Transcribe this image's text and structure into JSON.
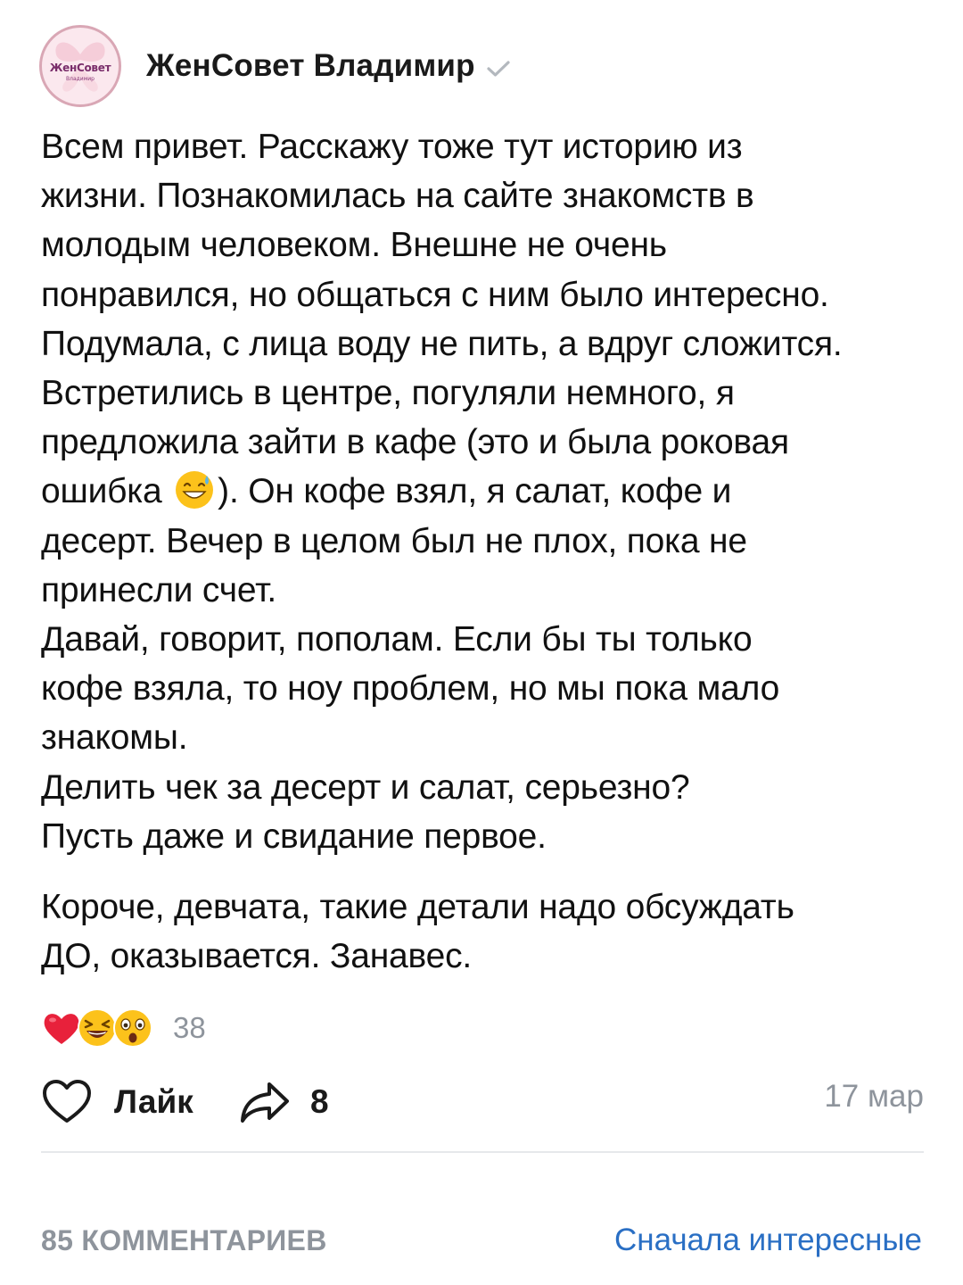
{
  "post": {
    "author": {
      "name": "ЖенСовет Владимир",
      "avatar_title": "ЖенСовет",
      "avatar_subtitle": "Владимир",
      "verified": true
    },
    "text": {
      "line_1": "Всем привет. Расскажу тоже тут историю из",
      "line_2": "жизни. Познакомилась на сайте знакомств в",
      "line_3": "молодым человеком. Внешне не очень",
      "line_4": "понравился, но общаться с ним было интересно.",
      "line_5": "Подумала, с лица воду не пить, а вдруг сложится.",
      "line_6": "Встретились в центре, погуляли немного, я",
      "line_7": "предложила зайти в кафе (это и была роковая",
      "line_8_before_emoji": "ошибка ",
      "line_8_after_emoji": "). Он кофе взял, я салат, кофе и",
      "line_9": "десерт. Вечер в целом был не плох, пока не",
      "line_10": "принесли счет.",
      "line_11": "Давай, говорит, пополам. Если бы ты только",
      "line_12": "кофе взяла, то ноу проблем, но мы пока мало",
      "line_13": "знакомы.",
      "line_14": "Делить чек за десерт и салат, серьезно?",
      "line_15": "Пусть даже и свидание первое.",
      "line_16": "Короче, девчата, такие детали надо обсуждать",
      "line_17": "ДО, оказывается. Занавес."
    },
    "inline_emoji": "grinning-face-with-sweat-icon",
    "reactions": {
      "icons": [
        "red-heart-icon",
        "laughing-squinting-face-icon",
        "astonished-face-icon"
      ],
      "count": "38"
    },
    "actions": {
      "like_label": "Лайк",
      "share_count": "8"
    },
    "date": "17 мар"
  },
  "comments": {
    "count_label": "85 КОММЕНТАРИЕВ",
    "sort_label": "Сначала интересные"
  },
  "colors": {
    "text": "#111111",
    "muted": "#8e949c",
    "link": "#2a6fc4",
    "divider": "#e6e8eb"
  }
}
